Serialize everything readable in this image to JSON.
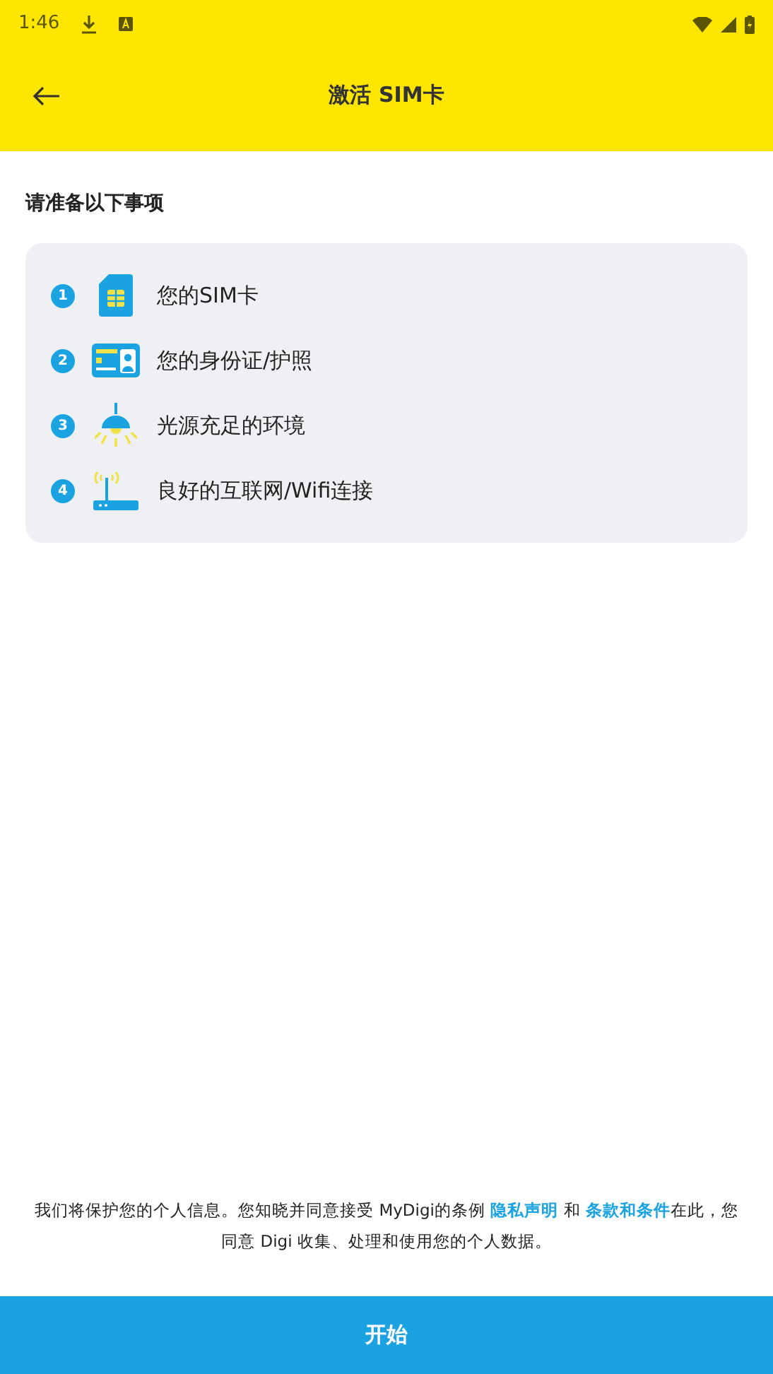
{
  "status_bar": {
    "time": "1:46"
  },
  "header": {
    "title": "激活 SIM卡"
  },
  "section": {
    "title": "请准备以下事项"
  },
  "items": [
    {
      "number": "1",
      "kind": "sim",
      "label": "您的SIM卡"
    },
    {
      "number": "2",
      "kind": "id",
      "label": "您的身份证/护照"
    },
    {
      "number": "3",
      "kind": "lamp",
      "label": "光源充足的环境"
    },
    {
      "number": "4",
      "kind": "router",
      "label": "良好的互联网/Wifi连接"
    }
  ],
  "consent": [
    {
      "kind": "text",
      "text": "我们将保护您的个人信息。您知晓并同意接受 MyDigi的条例 "
    },
    {
      "kind": "link",
      "text": "隐私声明"
    },
    {
      "kind": "text",
      "text": " 和 "
    },
    {
      "kind": "link",
      "text": "条款和条件"
    },
    {
      "kind": "text",
      "text": "在此，您同意 Digi 收集、处理和使用您的个人数据。"
    }
  ],
  "start_button": {
    "label": "开始"
  }
}
